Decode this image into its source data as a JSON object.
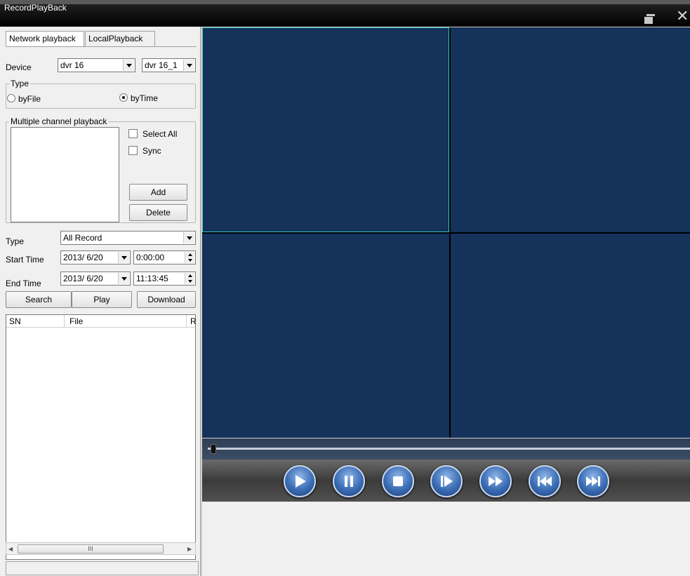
{
  "window": {
    "title": "RecordPlayBack"
  },
  "tabs": [
    {
      "label": "Network playback"
    },
    {
      "label": "LocalPlayback"
    }
  ],
  "device": {
    "label": "Device",
    "device_value": "dvr 16",
    "channel_value": "dvr 16_1"
  },
  "type_group": {
    "title": "Type",
    "option_file": "byFile",
    "option_time": "byTime",
    "selected": "byTime"
  },
  "multi_channel": {
    "title": "Multiple channel playback",
    "select_all": "Select All",
    "sync": "Sync",
    "add": "Add",
    "delete": "Delete"
  },
  "filter": {
    "type_label": "Type",
    "type_value": "All Record",
    "start_label": "Start Time",
    "start_date": "2013/ 6/20",
    "start_time": "0:00:00",
    "end_label": "End Time",
    "end_date": "2013/ 6/20",
    "end_time": "11:13:45"
  },
  "actions": {
    "search": "Search",
    "play": "Play",
    "download": "Download"
  },
  "table": {
    "columns": [
      "SN",
      "File",
      "R"
    ],
    "rows": []
  },
  "scroll": {
    "thumb_grip": "III"
  },
  "player": {
    "panes": 4,
    "selected_pane": 1,
    "pane_color": "#14325a",
    "selection_color": "#3cc8c8",
    "progress": 0,
    "controls": [
      "play-icon",
      "pause-icon",
      "stop-icon",
      "step-forward-icon",
      "fast-forward-icon",
      "skip-back-icon",
      "skip-forward-icon"
    ]
  }
}
